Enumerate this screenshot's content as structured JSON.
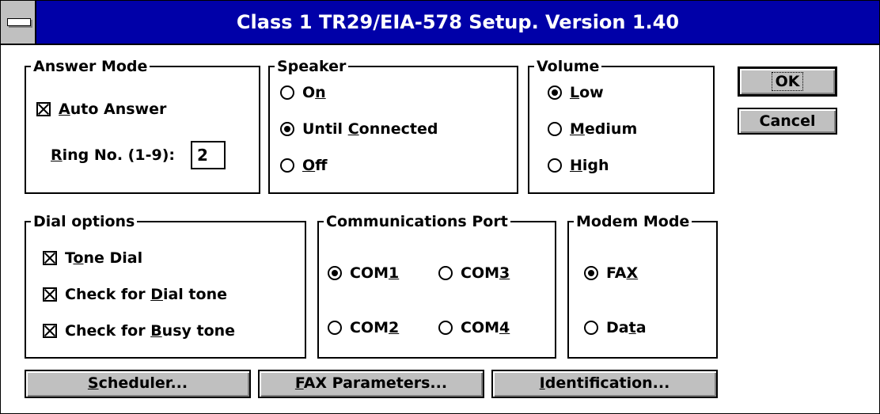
{
  "window": {
    "title": "Class 1 TR29/EIA-578 Setup. Version 1.40"
  },
  "answer_mode": {
    "legend": "Answer Mode",
    "auto_answer": {
      "pre": "",
      "key": "A",
      "post": "uto Answer",
      "checked": true
    },
    "ring": {
      "pre": "",
      "key": "R",
      "post": "ing No. (1-9):",
      "value": "2"
    }
  },
  "speaker": {
    "legend": "Speaker",
    "on": {
      "pre": "O",
      "key": "n",
      "post": "",
      "selected": false
    },
    "until": {
      "pre": "Until ",
      "key": "C",
      "post": "onnected",
      "selected": true
    },
    "off": {
      "pre": "",
      "key": "O",
      "post": "ff",
      "selected": false
    }
  },
  "volume": {
    "legend": "Volume",
    "low": {
      "pre": "",
      "key": "L",
      "post": "ow",
      "selected": true
    },
    "medium": {
      "pre": "",
      "key": "M",
      "post": "edium",
      "selected": false
    },
    "high": {
      "pre": "",
      "key": "H",
      "post": "igh",
      "selected": false
    }
  },
  "dial_options": {
    "legend": "Dial options",
    "tone": {
      "pre": "T",
      "key": "o",
      "post": "ne Dial",
      "checked": true
    },
    "dialtone": {
      "pre": "Check for ",
      "key": "D",
      "post": "ial tone",
      "checked": true
    },
    "busy": {
      "pre": "Check for ",
      "key": "B",
      "post": "usy tone",
      "checked": true
    }
  },
  "comm_port": {
    "legend": "Communications Port",
    "com1": {
      "pre": "COM",
      "key": "1",
      "post": "",
      "selected": true
    },
    "com2": {
      "pre": "COM",
      "key": "2",
      "post": "",
      "selected": false
    },
    "com3": {
      "pre": "COM",
      "key": "3",
      "post": "",
      "selected": false
    },
    "com4": {
      "pre": "COM",
      "key": "4",
      "post": "",
      "selected": false
    }
  },
  "modem_mode": {
    "legend": "Modem Mode",
    "fax": {
      "pre": "FA",
      "key": "X",
      "post": "",
      "selected": true
    },
    "data": {
      "pre": "Da",
      "key": "t",
      "post": "a",
      "selected": false
    }
  },
  "buttons": {
    "ok": "OK",
    "cancel": "Cancel",
    "scheduler": {
      "pre": "",
      "key": "S",
      "post": "cheduler..."
    },
    "fax_params": {
      "pre": "",
      "key": "F",
      "post": "AX Parameters..."
    },
    "identification": {
      "pre": "",
      "key": "I",
      "post": "dentification..."
    }
  }
}
